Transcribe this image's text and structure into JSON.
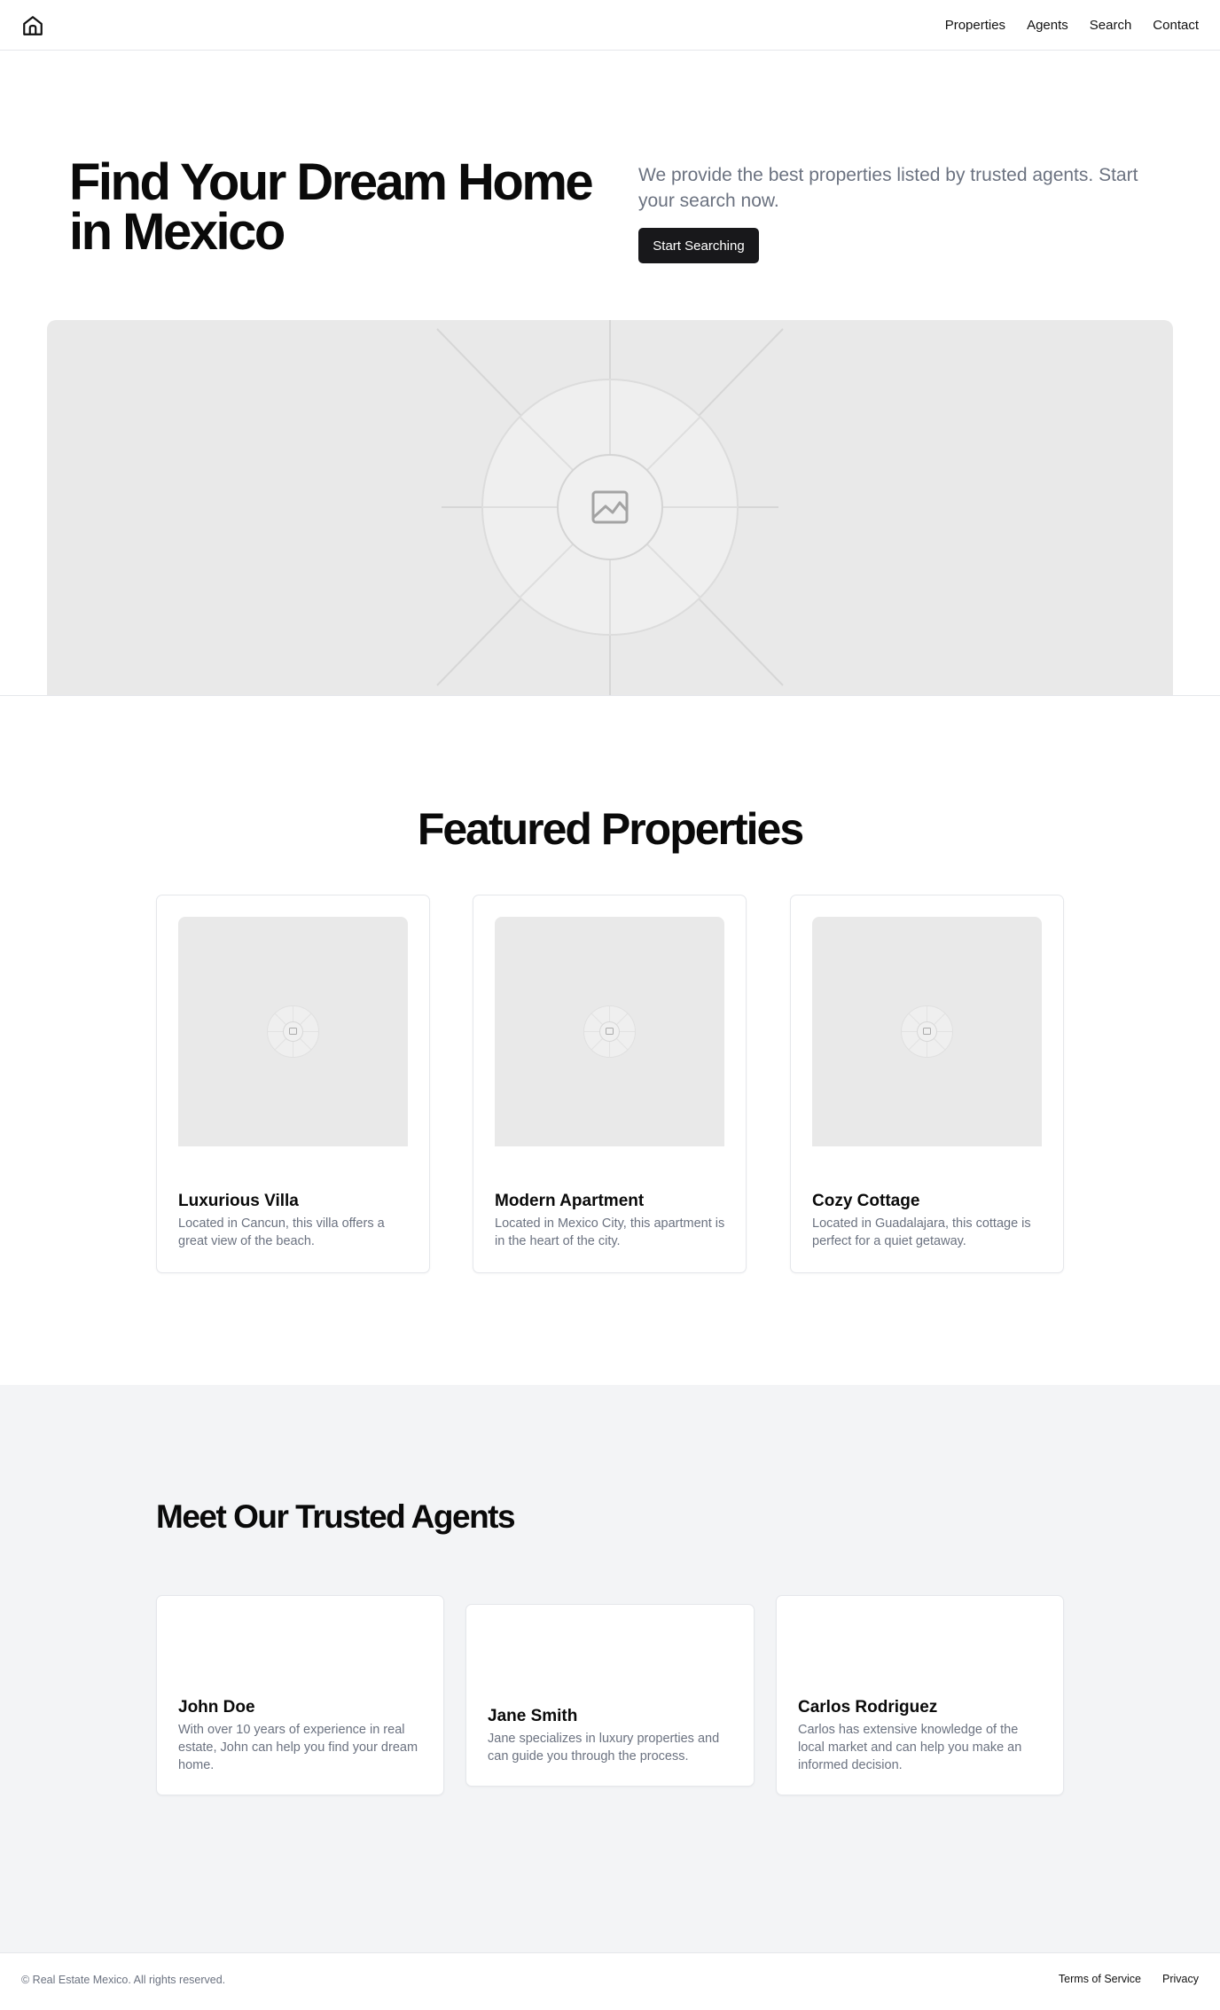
{
  "header": {
    "logo_icon": "home-icon",
    "nav": [
      "Properties",
      "Agents",
      "Search",
      "Contact"
    ]
  },
  "hero": {
    "title_line1": "Find Your Dream Home",
    "title_line2": "in Mexico",
    "subtitle": "We provide the best properties listed by trusted agents. Start your search now.",
    "cta": "Start Searching",
    "image_icon": "image-placeholder-icon"
  },
  "featured": {
    "title": "Featured Properties",
    "properties": [
      {
        "name": "Luxurious Villa",
        "description": "Located in Cancun, this villa offers a great view of the beach."
      },
      {
        "name": "Modern Apartment",
        "description": "Located in Mexico City, this apartment is in the heart of the city."
      },
      {
        "name": "Cozy Cottage",
        "description": "Located in Guadalajara, this cottage is perfect for a quiet getaway."
      }
    ]
  },
  "agents": {
    "title": "Meet Our Trusted Agents",
    "list": [
      {
        "name": "John Doe",
        "bio": "With over 10 years of experience in real estate, John can help you find your dream home."
      },
      {
        "name": "Jane Smith",
        "bio": "Jane specializes in luxury properties and can guide you through the process."
      },
      {
        "name": "Carlos Rodriguez",
        "bio": "Carlos has extensive knowledge of the local market and can help you make an informed decision."
      }
    ]
  },
  "footer": {
    "copyright": "© Real Estate Mexico. All rights reserved.",
    "links": [
      "Terms of Service",
      "Privacy"
    ]
  },
  "colors": {
    "accent": "#18181b",
    "muted_text": "#6b7280",
    "section_bg": "#f3f4f6",
    "placeholder_bg": "#e9e9e9"
  }
}
